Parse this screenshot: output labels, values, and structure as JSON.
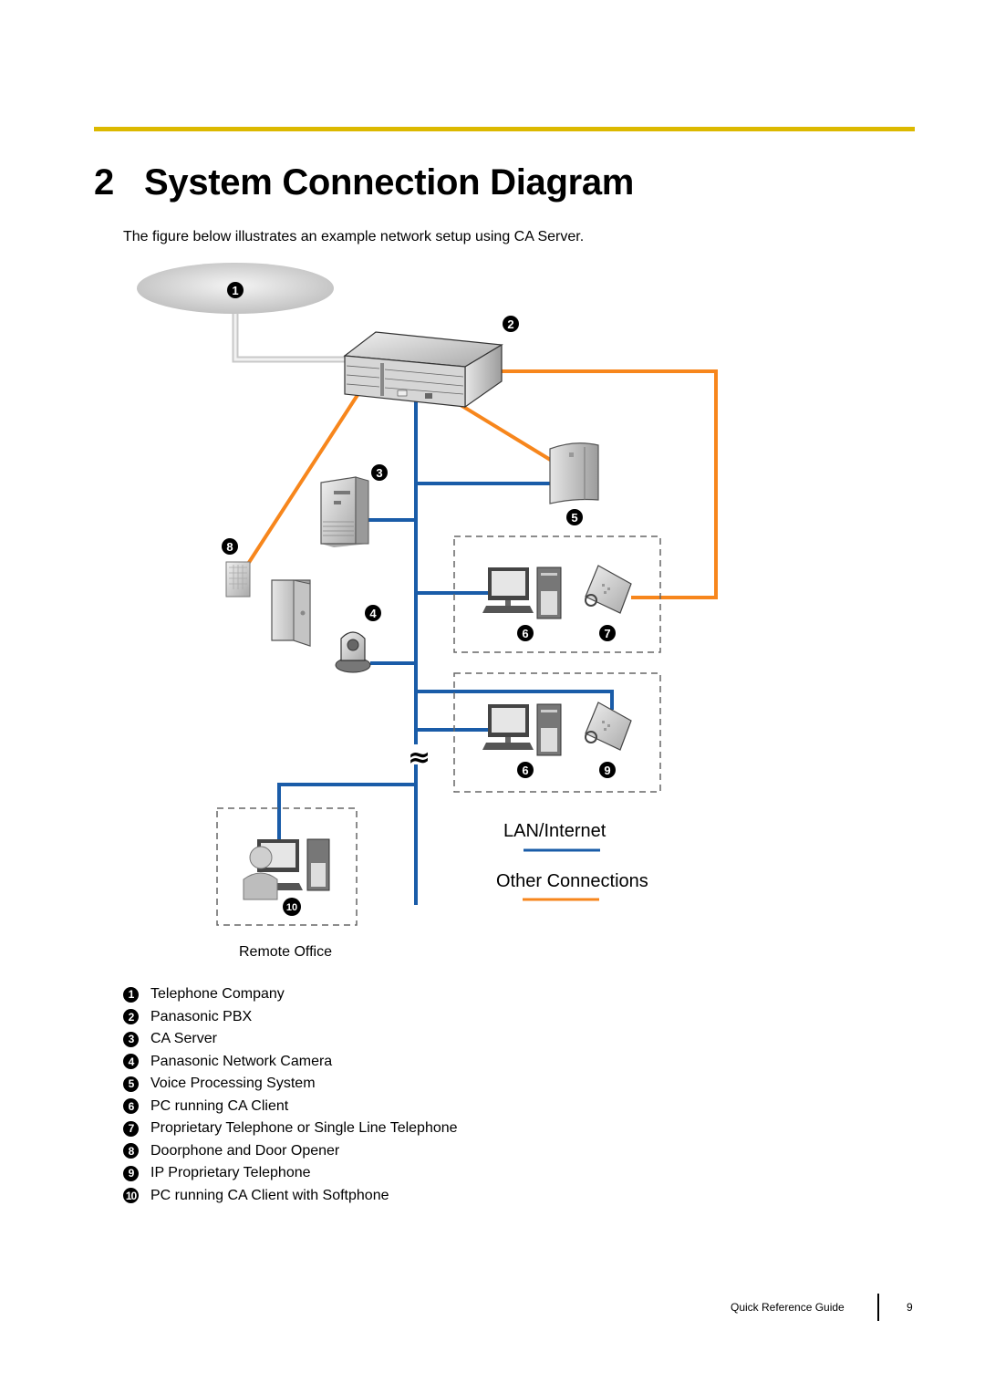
{
  "page": {
    "section_number": "2",
    "title": "System Connection Diagram",
    "intro": "The figure below illustrates an example network setup using CA Server.",
    "accent_color": "#dcb900"
  },
  "diagram": {
    "nodes": [
      {
        "id": 1,
        "badge": "1",
        "name": "Telephone Company"
      },
      {
        "id": 2,
        "badge": "2",
        "name": "Panasonic PBX"
      },
      {
        "id": 3,
        "badge": "3",
        "name": "CA Server"
      },
      {
        "id": 4,
        "badge": "4",
        "name": "Panasonic Network Camera"
      },
      {
        "id": 5,
        "badge": "5",
        "name": "Voice Processing System"
      },
      {
        "id": 6,
        "badge": "6",
        "name": "PC running CA Client"
      },
      {
        "id": 7,
        "badge": "7",
        "name": "Proprietary Telephone or Single Line Telephone"
      },
      {
        "id": 8,
        "badge": "8",
        "name": "Doorphone and Door Opener"
      },
      {
        "id": 9,
        "badge": "9",
        "name": "IP Proprietary Telephone"
      },
      {
        "id": 10,
        "badge": "10",
        "name": "PC running CA Client with Softphone"
      }
    ],
    "remote_office_label": "Remote Office",
    "legend": {
      "lan": {
        "label": "LAN/Internet",
        "color": "#1a5ca8"
      },
      "other": {
        "label": "Other Connections",
        "color": "#f7861c"
      }
    },
    "break_symbol": "≈"
  },
  "items": [
    {
      "badge": "1",
      "label": "Telephone Company"
    },
    {
      "badge": "2",
      "label": "Panasonic PBX"
    },
    {
      "badge": "3",
      "label": "CA Server"
    },
    {
      "badge": "4",
      "label": "Panasonic Network Camera"
    },
    {
      "badge": "5",
      "label": "Voice Processing System"
    },
    {
      "badge": "6",
      "label": "PC running CA Client"
    },
    {
      "badge": "7",
      "label": "Proprietary Telephone or Single Line Telephone"
    },
    {
      "badge": "8",
      "label": "Doorphone and Door Opener"
    },
    {
      "badge": "9",
      "label": "IP Proprietary Telephone"
    },
    {
      "badge": "10",
      "label": "PC running CA Client with Softphone"
    }
  ],
  "footer": {
    "guide": "Quick Reference Guide",
    "page_number": "9"
  }
}
